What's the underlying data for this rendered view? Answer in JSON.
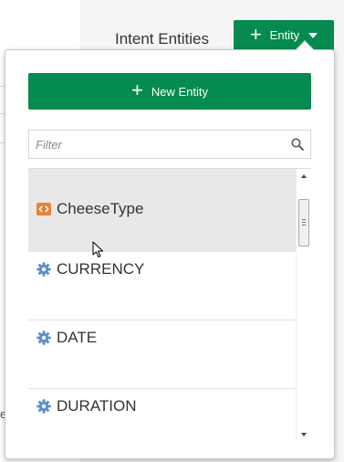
{
  "header": {
    "title": "Intent Entities",
    "entity_button_label": "Entity",
    "entity_button_icon": "plus-icon",
    "entity_button_caret": "caret-down-icon"
  },
  "background": {
    "edge_text": "er"
  },
  "popup": {
    "new_entity_label": "New Entity",
    "filter": {
      "value": "",
      "placeholder": "Filter",
      "icon": "search-icon"
    },
    "items": [
      {
        "label": "CheeseType",
        "icon": "custom-entity-icon",
        "hovered": true
      },
      {
        "label": "CURRENCY",
        "icon": "gear-icon"
      },
      {
        "label": "DATE",
        "icon": "gear-icon"
      },
      {
        "label": "DURATION",
        "icon": "gear-icon"
      }
    ]
  },
  "colors": {
    "accent_green": "#058a4f",
    "custom_entity_orange": "#e8823a",
    "builtin_entity_blue": "#5b8fc9",
    "hover_row": "#e8e8e8"
  }
}
